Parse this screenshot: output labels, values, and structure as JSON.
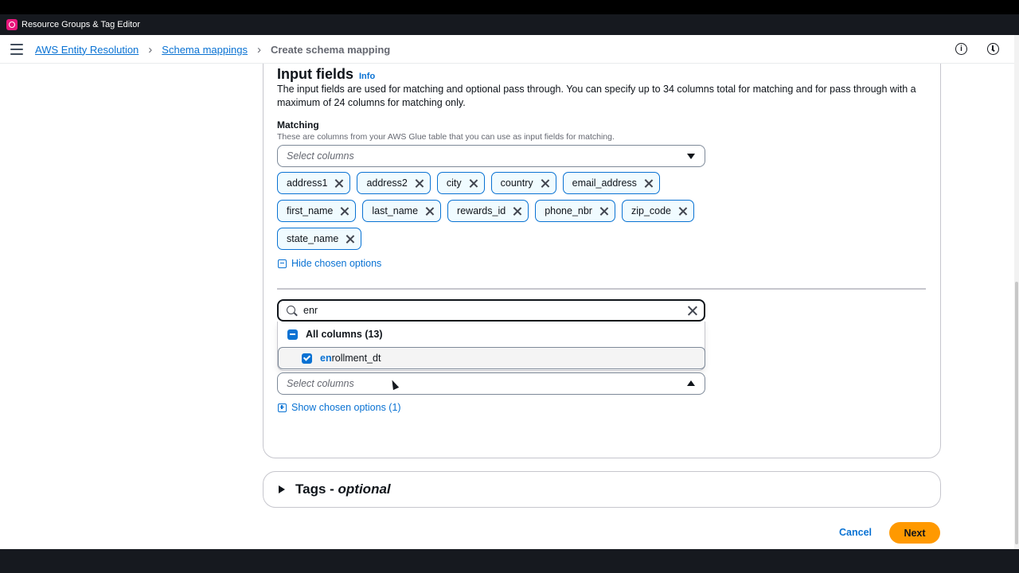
{
  "app": {
    "service_label": "Resource Groups & Tag Editor"
  },
  "breadcrumbs": [
    {
      "label": "AWS Entity Resolution"
    },
    {
      "label": "Schema mappings"
    },
    {
      "label": "Create schema mapping"
    }
  ],
  "input_fields": {
    "title": "Input fields",
    "info_label": "Info",
    "description": "The input fields are used for matching and optional pass through. You can specify up to 34 columns total for matching and for pass through with a maximum of 24 columns for matching only.",
    "matching": {
      "label": "Matching",
      "hint": "These are columns from your AWS Glue table that you can use as input fields for matching.",
      "placeholder": "Select columns",
      "tokens_row1": [
        "address1",
        "address2",
        "city",
        "country",
        "email_address"
      ],
      "tokens_row2": [
        "first_name",
        "last_name",
        "rewards_id",
        "phone_nbr",
        "zip_code"
      ],
      "tokens_row3": [
        "state_name"
      ],
      "hide_options_label": "Hide chosen options"
    },
    "pass_through": {
      "search_value": "enr",
      "all_columns_label": "All columns (13)",
      "option_match": "en",
      "option_rest": "rollment_dt",
      "placeholder": "Select columns",
      "show_options_label": "Show chosen options (1)"
    }
  },
  "tags": {
    "title": "Tags - ",
    "optional": "optional"
  },
  "actions": {
    "cancel": "Cancel",
    "next": "Next"
  },
  "colors": {
    "accent": "#0972d3",
    "primary_button": "#ff9900",
    "header_bg": "#16191f"
  }
}
